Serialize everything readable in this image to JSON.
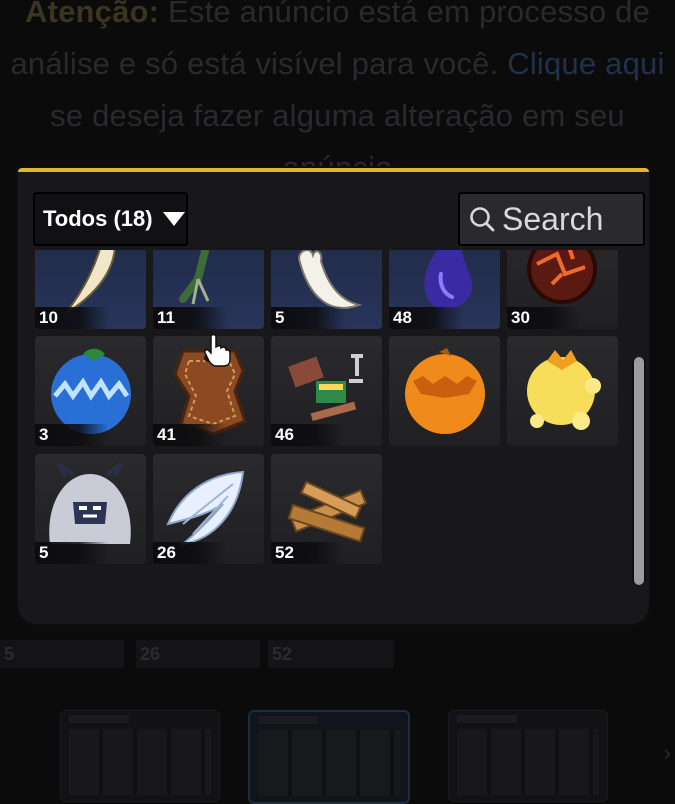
{
  "background_notice": {
    "warning_label": "Atenção:",
    "text_before_link": " Este anúncio está em processo de análise e só está visível para você. ",
    "link_text": "Clique aqui",
    "text_after_link": " se deseja fazer alguma alteração em seu anúncio"
  },
  "inventory": {
    "filter_label": "Todos (18)",
    "search_placeholder": "Search",
    "accent_color": "#e3b52a",
    "rows": [
      [
        {
          "icon": "fang-icon",
          "qty": "10"
        },
        {
          "icon": "herb-icon",
          "qty": "11"
        },
        {
          "icon": "tooth-icon",
          "qty": "5"
        },
        {
          "icon": "dark-fluid-icon",
          "qty": "48"
        },
        {
          "icon": "magma-ore-icon",
          "qty": "30"
        }
      ],
      [
        {
          "icon": "ice-fruit-icon",
          "qty": "3"
        },
        {
          "icon": "leather-icon",
          "qty": "41"
        },
        {
          "icon": "scrap-metal-icon",
          "qty": "46"
        },
        {
          "icon": "orange-fruit-icon",
          "qty": ""
        },
        {
          "icon": "light-fruit-icon",
          "qty": ""
        }
      ],
      [
        {
          "icon": "yeti-fur-icon",
          "qty": "5"
        },
        {
          "icon": "angel-wings-icon",
          "qty": "26"
        },
        {
          "icon": "wood-planks-icon",
          "qty": "52"
        }
      ]
    ]
  },
  "background_strip": {
    "values": [
      "5",
      "26",
      "52"
    ]
  }
}
